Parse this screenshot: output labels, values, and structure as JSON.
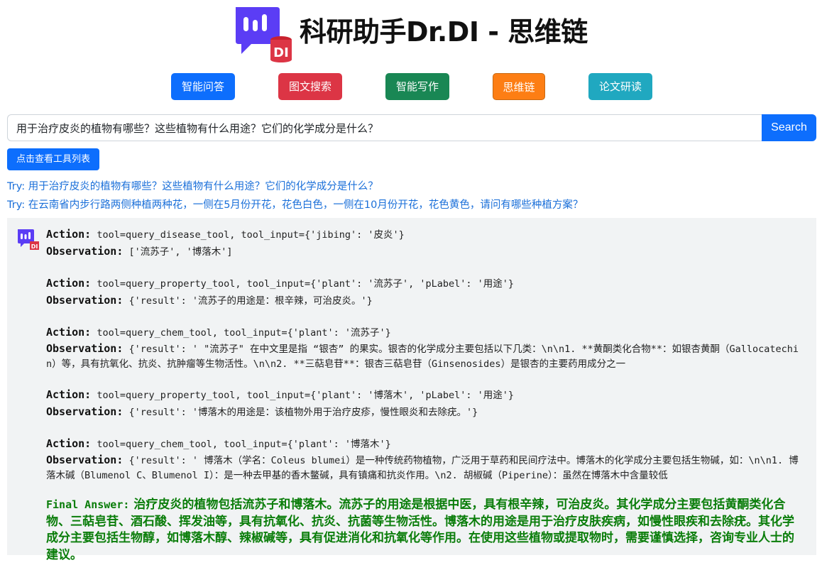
{
  "app": {
    "title": "科研助手Dr.DI - 思维链",
    "logo_badge": "DI",
    "colors": {
      "accent": "#0d6efd",
      "logo_purple": "#5b3df5",
      "badge_red": "#dc3545",
      "final_green": "#0a7d0a"
    }
  },
  "nav": {
    "items": [
      {
        "label": "智能问答",
        "color": "#0d6efd"
      },
      {
        "label": "图文搜索",
        "color": "#dc3545"
      },
      {
        "label": "智能写作",
        "color": "#198754"
      },
      {
        "label": "思维链",
        "color": "#fd7e14",
        "active": true
      },
      {
        "label": "论文研读",
        "color": "#20a8c0"
      }
    ]
  },
  "search": {
    "value": "用于治疗皮炎的植物有哪些？这些植物有什么用途？它们的化学成分是什么？",
    "button_label": "Search",
    "icon": "search-icon"
  },
  "tools_button": {
    "label": "点击查看工具列表"
  },
  "try_links": [
    "Try: 用于治疗皮炎的植物有哪些？这些植物有什么用途？它们的化学成分是什么？",
    "Try: 在云南省内步行路两侧种植两种花，一侧在5月份开花，花色白色，一侧在10月份开花，花色黄色，请问有哪些种植方案？"
  ],
  "result": {
    "avatar_badge": "DI",
    "action_label": "Action:",
    "observation_label": "Observation:",
    "steps": [
      {
        "action": "tool=query_disease_tool, tool_input={'jibing': '皮炎'}",
        "observation": "['流苏子', '博落木']"
      },
      {
        "action": "tool=query_property_tool, tool_input={'plant': '流苏子', 'pLabel': '用途'}",
        "observation": "{'result': '流苏子的用途是：根辛辣，可治皮炎。'}"
      },
      {
        "action": "tool=query_chem_tool, tool_input={'plant': '流苏子'}",
        "observation": "{'result': ' \"流苏子\" 在中文里是指 “银杏” 的果实。银杏的化学成分主要包括以下几类：\\n\\n1. **黄酮类化合物**：如银杏黄酮（Gallocatechin）等，具有抗氧化、抗炎、抗肿瘤等生物活性。\\n\\n2. **三萜皂苷**：银杏三萜皂苷（Ginsenosides）是银杏的主要药用成分之一"
      },
      {
        "action": "tool=query_property_tool, tool_input={'plant': '博落木', 'pLabel': '用途'}",
        "observation": "{'result': '博落木的用途是：该植物外用于治疗皮疹，慢性眼炎和去除疣。'}"
      },
      {
        "action": "tool=query_chem_tool, tool_input={'plant': '博落木'}",
        "observation": "{'result': ' 博落木（学名：Coleus blumei）是一种传统药物植物，广泛用于草药和民间疗法中。博落木的化学成分主要包括生物碱，如：\\n\\n1. 博落木碱（Blumenol C、Blumenol I）：是一种去甲基的香木鳖碱，具有镇痛和抗炎作用。\\n2. 胡椒碱（Piperine）：虽然在博落木中含量较低"
      }
    ],
    "final_label": "Final Answer:",
    "final_answer": "治疗皮炎的植物包括流苏子和博落木。流苏子的用途是根据中医，具有根辛辣，可治皮炎。其化学成分主要包括黄酮类化合物、三萜皂苷、酒石酸、挥发油等，具有抗氧化、抗炎、抗菌等生物活性。博落木的用途是用于治疗皮肤疾病，如慢性眼疾和去除疣。其化学成分主要包括生物醇，如博落木醇、辣椒碱等，具有促进消化和抗氧化等作用。在使用这些植物或提取物时，需要谨慎选择，咨询专业人士的建议。"
  }
}
